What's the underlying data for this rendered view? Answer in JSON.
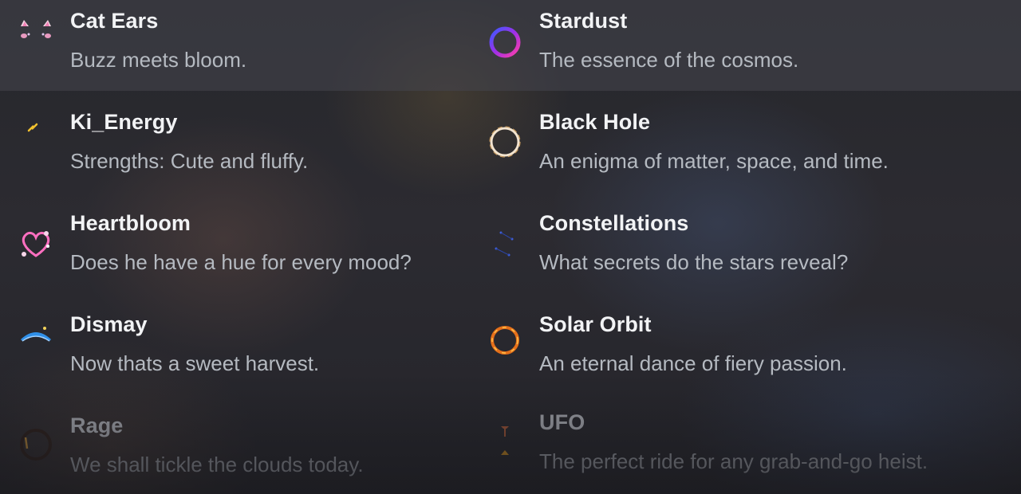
{
  "decorations": [
    {
      "icon": "cat-ears-icon",
      "title": "Cat Ears",
      "description": "Buzz meets bloom.",
      "hovered": true
    },
    {
      "icon": "stardust-icon",
      "title": "Stardust",
      "description": "The essence of the cosmos.",
      "hovered": true
    },
    {
      "icon": "ki-energy-icon",
      "title": "Ki_Energy",
      "description": "Strengths: Cute and fluffy."
    },
    {
      "icon": "black-hole-icon",
      "title": "Black Hole",
      "description": "An enigma of matter, space, and time."
    },
    {
      "icon": "heartbloom-icon",
      "title": "Heartbloom",
      "description": "Does he have a hue for every mood?"
    },
    {
      "icon": "constellations-icon",
      "title": "Constellations",
      "description": "What secrets do the stars reveal?"
    },
    {
      "icon": "dismay-icon",
      "title": "Dismay",
      "description": "Now thats a sweet harvest."
    },
    {
      "icon": "solar-orbit-icon",
      "title": "Solar Orbit",
      "description": "An eternal dance of fiery passion."
    },
    {
      "icon": "rage-icon",
      "title": "Rage",
      "description": "We shall tickle the clouds today.",
      "dim": true
    },
    {
      "icon": "ufo-icon",
      "title": "UFO",
      "description": "The perfect ride for any grab-and-go heist.",
      "dim": true
    }
  ],
  "colors": {
    "title": "#f2f3f5",
    "description": "#b5bac1",
    "hover_background": "#3f3f46"
  }
}
